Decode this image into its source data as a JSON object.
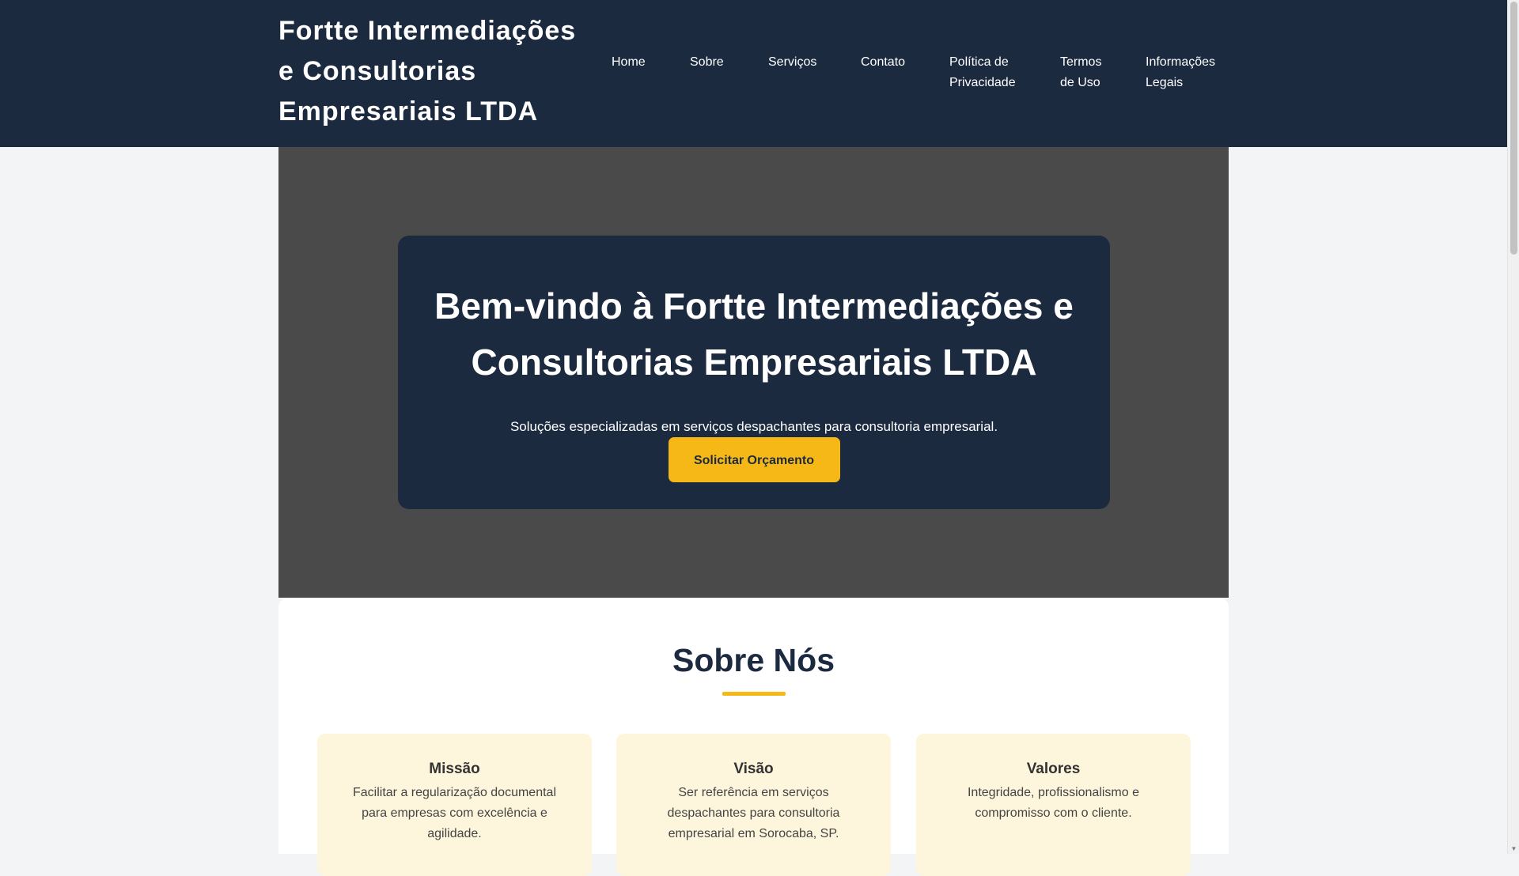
{
  "header": {
    "brand": "Fortte Intermediações e Consultorias Empresariais LTDA",
    "nav": [
      {
        "label": "Home"
      },
      {
        "label": "Sobre"
      },
      {
        "label": "Serviços"
      },
      {
        "label": "Contato"
      },
      {
        "label": "Política de Privacidade"
      },
      {
        "label": "Termos de Uso"
      },
      {
        "label": "Informações Legais"
      }
    ]
  },
  "hero": {
    "title": "Bem-vindo à Fortte Intermediações e Consultorias Empresariais LTDA",
    "subtitle": "Soluções especializadas em serviços despachantes para consultoria empresarial.",
    "cta_label": "Solicitar Orçamento"
  },
  "about": {
    "title": "Sobre Nós",
    "cards": [
      {
        "title": "Missão",
        "text": "Facilitar a regularização documental para empresas com excelência e agilidade."
      },
      {
        "title": "Visão",
        "text": "Ser referência em serviços despachantes para consultoria empresarial em Sorocaba, SP."
      },
      {
        "title": "Valores",
        "text": "Integridade, profissionalismo e compromisso com o cliente."
      }
    ]
  },
  "colors": {
    "navy": "#1c2a40",
    "accent": "#f6b817",
    "hero_bg": "#4a4a4a",
    "card_bg": "#fdf5dc"
  }
}
